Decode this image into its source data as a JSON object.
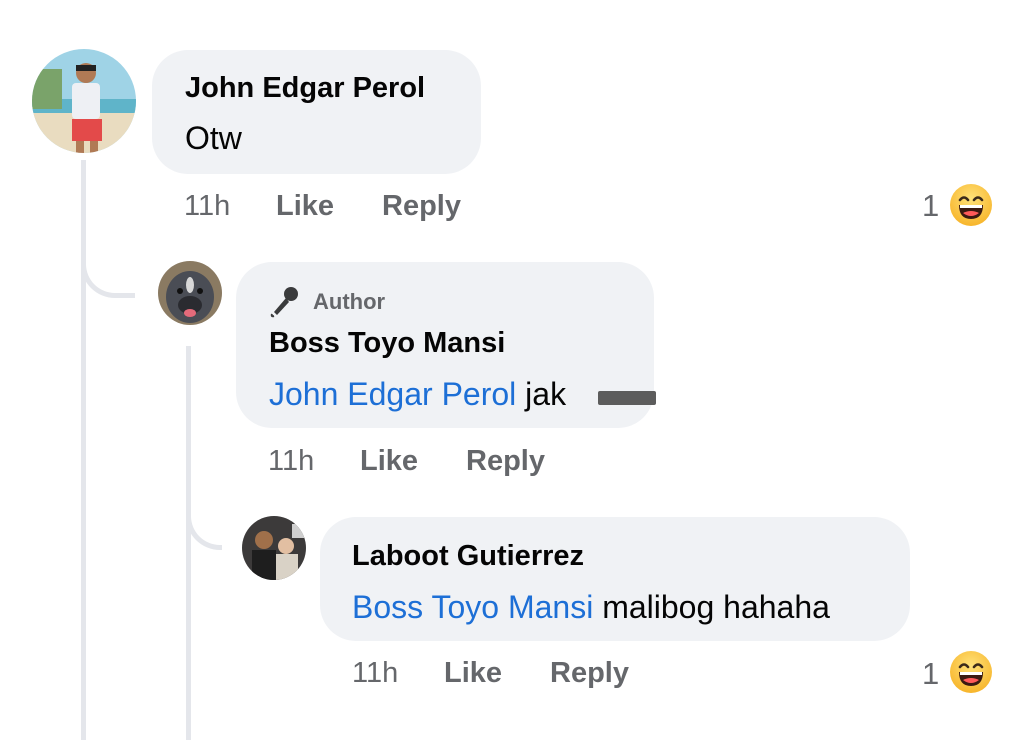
{
  "comments": [
    {
      "author": "John Edgar Perol",
      "text": "Otw",
      "time": "11h",
      "like_label": "Like",
      "reply_label": "Reply",
      "reaction_count": "1",
      "reaction_icon": "grinning-squinting-face-emoji"
    },
    {
      "badge": "Author",
      "badge_icon": "microphone-icon",
      "author": "Boss Toyo Mansi",
      "mention": "John Edgar Perol",
      "text": "jak",
      "time": "11h",
      "like_label": "Like",
      "reply_label": "Reply"
    },
    {
      "author": "Laboot Gutierrez",
      "mention": "Boss Toyo Mansi",
      "text": "malibog hahaha",
      "time": "11h",
      "like_label": "Like",
      "reply_label": "Reply",
      "reaction_count": "1",
      "reaction_icon": "grinning-squinting-face-emoji"
    }
  ],
  "colors": {
    "bubble": "#f0f2f5",
    "mention": "#1d6fd6",
    "meta": "#65676b",
    "thread_line": "#e4e6eb"
  }
}
